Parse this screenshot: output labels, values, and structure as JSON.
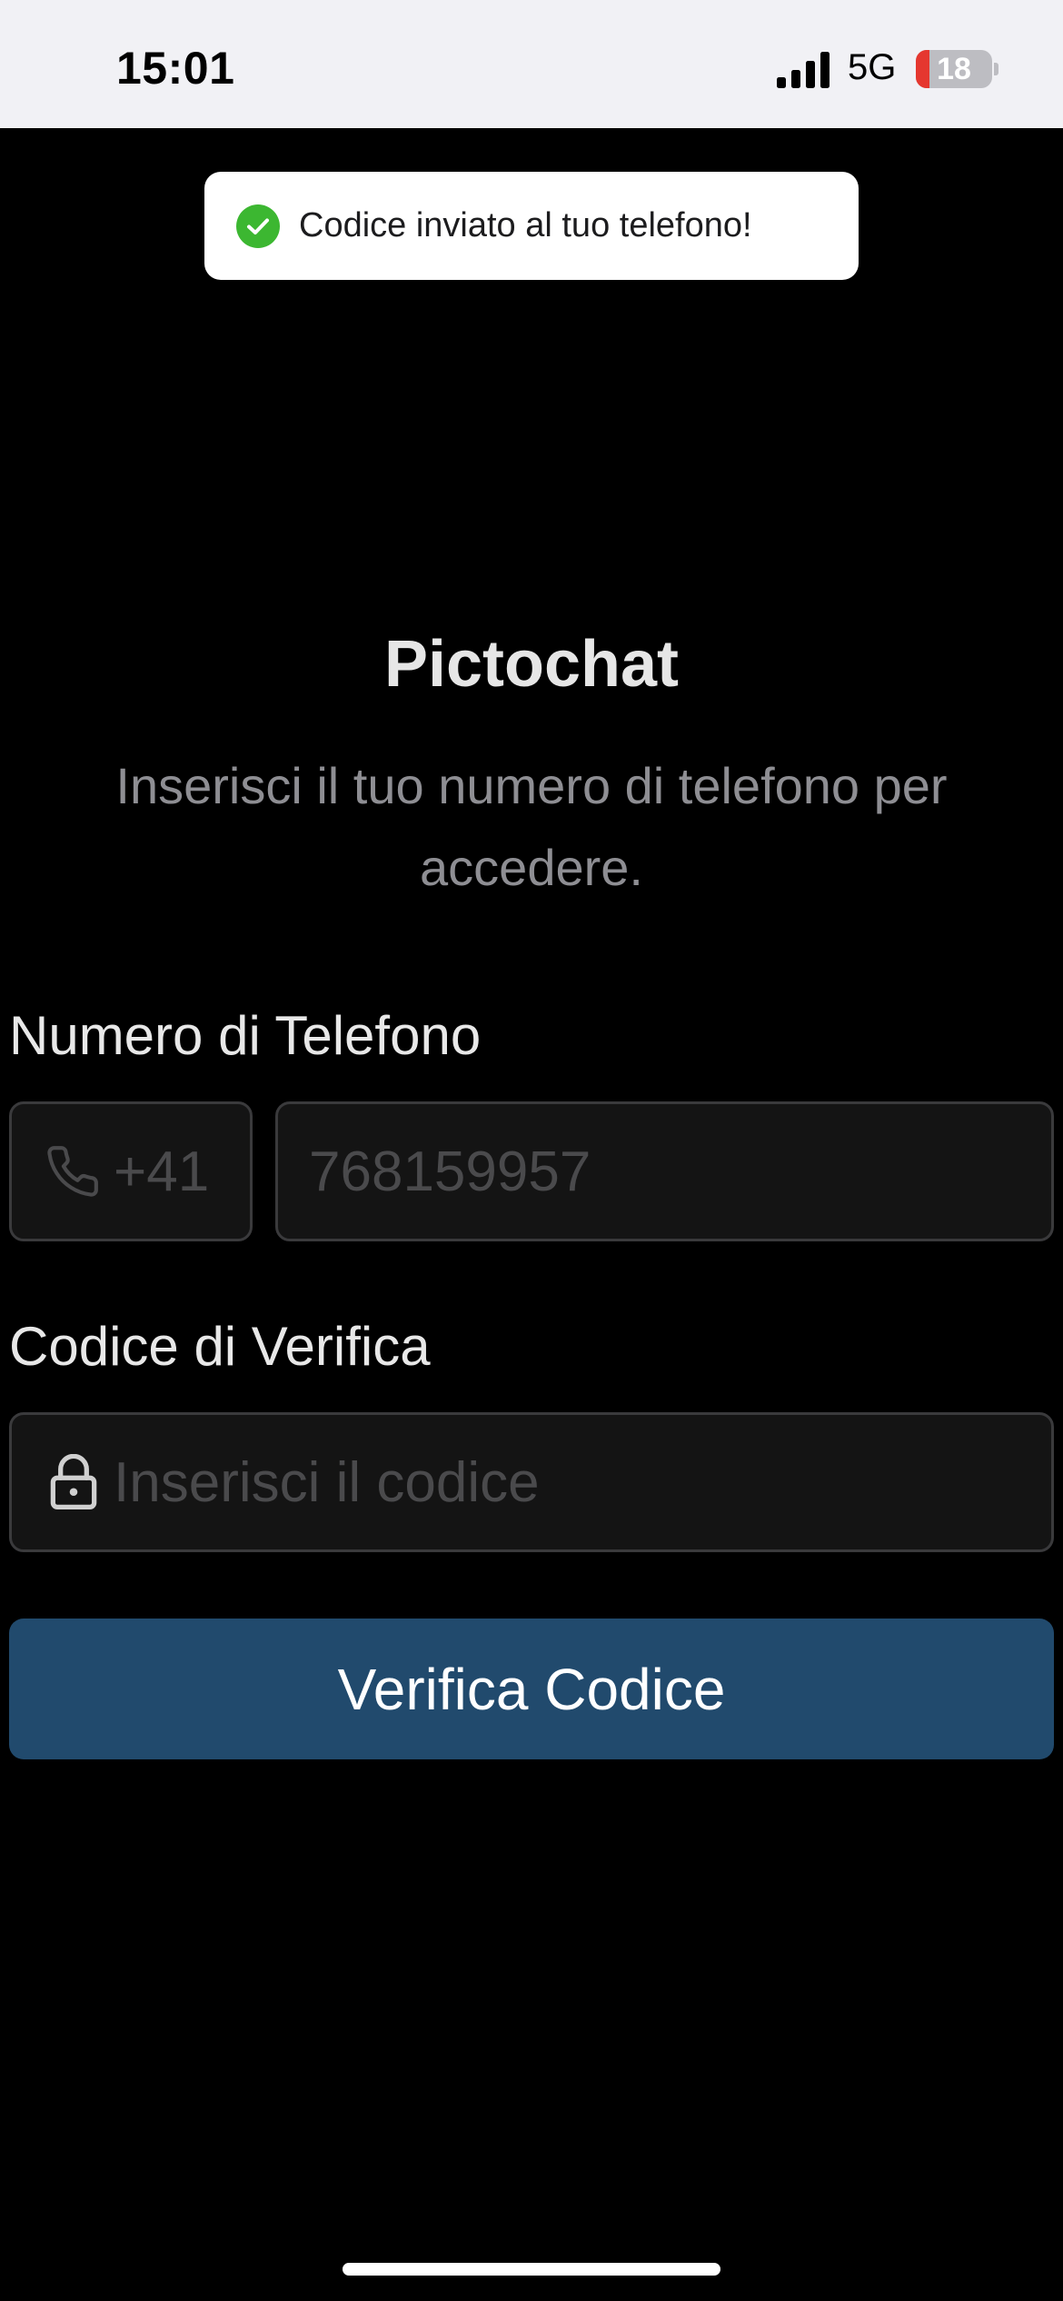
{
  "status_bar": {
    "time": "15:01",
    "network": "5G",
    "battery_level": 18,
    "battery_text": "18",
    "battery_color": "#e5372f",
    "signal_icon": "cellular-signal-icon"
  },
  "toast": {
    "icon": "check-circle-icon",
    "icon_color": "#3cb731",
    "message": "Codice inviato al tuo telefono!"
  },
  "header": {
    "title": "Pictochat",
    "subtitle": "Inserisci il tuo numero di telefono per accedere."
  },
  "phone": {
    "label": "Numero di Telefono",
    "country_icon": "phone-icon",
    "country_code": "+41",
    "placeholder": "768159957",
    "value": ""
  },
  "code": {
    "label": "Codice di Verifica",
    "icon": "lock-icon",
    "placeholder": "Inserisci il codice",
    "value": ""
  },
  "verify_button": {
    "label": "Verifica Codice",
    "color": "#214a6d"
  }
}
